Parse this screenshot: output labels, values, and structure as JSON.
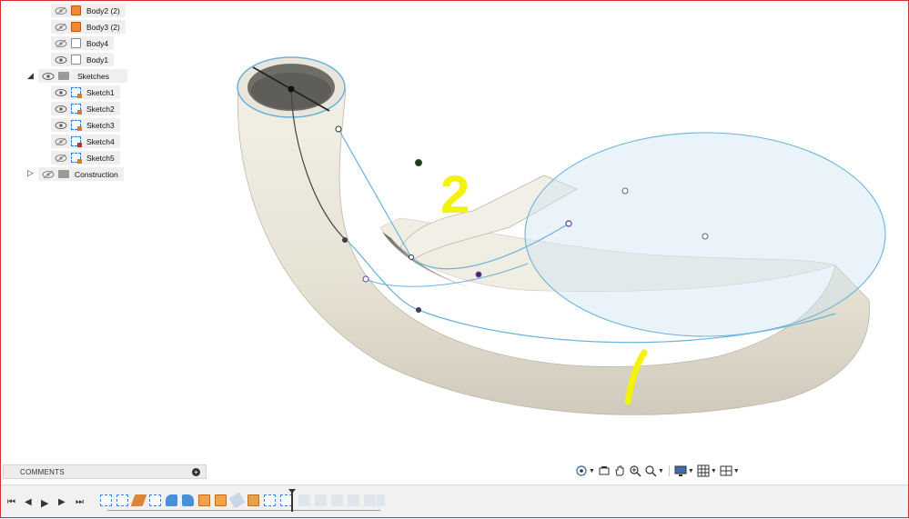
{
  "browser": {
    "bodies": [
      {
        "label": "Body2 (2)",
        "icon": "orange-body-icon"
      },
      {
        "label": "Body3 (2)",
        "icon": "orange-body-icon"
      },
      {
        "label": "Body4",
        "icon": "body-icon"
      },
      {
        "label": "Body1",
        "icon": "body-icon"
      }
    ],
    "sketches_folder": "Sketches",
    "sketches": [
      {
        "label": "Sketch1"
      },
      {
        "label": "Sketch2"
      },
      {
        "label": "Sketch3"
      },
      {
        "label": "Sketch4"
      },
      {
        "label": "Sketch5"
      }
    ],
    "construction_folder": "Construction"
  },
  "annotations": {
    "label_2": "2"
  },
  "comments": {
    "label": "COMMENTS"
  },
  "colors": {
    "model_fill": "#ece8dc",
    "sketch_line": "#6ab4dc",
    "highlight": "#f2f20a",
    "frame": "#d43030"
  }
}
